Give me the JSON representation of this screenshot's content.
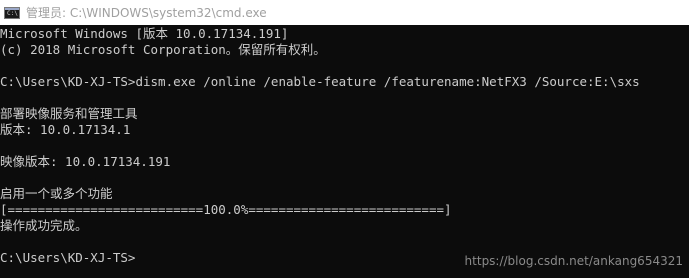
{
  "window": {
    "title": "管理员: C:\\WINDOWS\\system32\\cmd.exe",
    "icon": "cmd-icon",
    "icon_glyph": "C:\\"
  },
  "console": {
    "lines": [
      "Microsoft Windows [版本 10.0.17134.191]",
      "(c) 2018 Microsoft Corporation。保留所有权利。",
      "",
      "C:\\Users\\KD-XJ-TS>dism.exe /online /enable-feature /featurename:NetFX3 /Source:E:\\sxs",
      "",
      "部署映像服务和管理工具",
      "版本: 10.0.17134.1",
      "",
      "映像版本: 10.0.17134.191",
      "",
      "启用一个或多个功能",
      "[==========================100.0%==========================]",
      "操作成功完成。",
      "",
      "C:\\Users\\KD-XJ-TS>"
    ]
  },
  "watermark": "https://blog.csdn.net/ankang654321",
  "colors": {
    "console_bg": "#0c0c0c",
    "console_text": "#cccccc",
    "titlebar_bg": "#ffffff",
    "title_text": "#a0a0a0"
  }
}
